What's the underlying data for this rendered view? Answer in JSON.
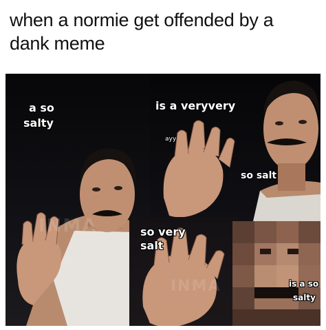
{
  "caption": "when a normie get offended by a dank meme",
  "meme": {
    "panel1": {
      "text_line1": "a so",
      "text_line2": "salty"
    },
    "panel2": {
      "text_top": "is a veryvery",
      "text_small": "ayy",
      "text_mid": "so salt"
    },
    "panel3": {
      "text_line1": "so very",
      "text_line2": "salt"
    },
    "panel4": {
      "text_line1": "is a so",
      "text_line2": "salty"
    },
    "watermark": "INMA"
  }
}
